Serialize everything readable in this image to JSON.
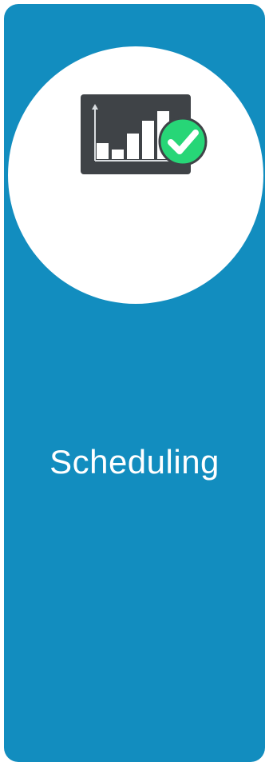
{
  "card": {
    "title": "Scheduling",
    "icon": "chart-check-icon",
    "colors": {
      "card_background": "#128dbf",
      "circle_background": "#ffffff",
      "icon_panel": "#3f4347",
      "icon_bars": "#ffffff",
      "check_badge": "#27d677",
      "check_mark": "#ffffff"
    }
  }
}
